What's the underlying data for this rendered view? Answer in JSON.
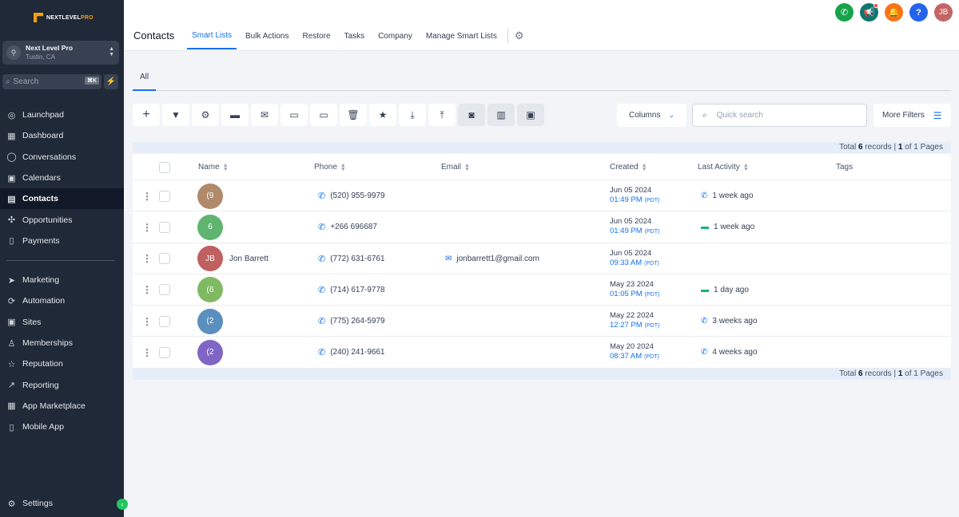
{
  "sidebar": {
    "logo_text_a": "NEXTLEVEL",
    "logo_text_b": "PRO",
    "account": {
      "name": "Next Level Pro",
      "location": "Tustin, CA"
    },
    "search": {
      "placeholder": "Search",
      "shortcut": "⌘K"
    },
    "nav_top": [
      {
        "label": "Launchpad",
        "icon": "rocket-icon",
        "glyph": "◎"
      },
      {
        "label": "Dashboard",
        "icon": "dashboard-icon",
        "glyph": "▦"
      },
      {
        "label": "Conversations",
        "icon": "chat-icon",
        "glyph": "◯"
      },
      {
        "label": "Calendars",
        "icon": "calendar-icon",
        "glyph": "▣"
      },
      {
        "label": "Contacts",
        "icon": "contacts-icon",
        "glyph": "▤",
        "active": true
      },
      {
        "label": "Opportunities",
        "icon": "opportunities-icon",
        "glyph": "✣"
      },
      {
        "label": "Payments",
        "icon": "payments-icon",
        "glyph": "▯"
      }
    ],
    "nav_bottom": [
      {
        "label": "Marketing",
        "icon": "send-icon",
        "glyph": "➤"
      },
      {
        "label": "Automation",
        "icon": "automation-icon",
        "glyph": "⟳"
      },
      {
        "label": "Sites",
        "icon": "sites-icon",
        "glyph": "▣"
      },
      {
        "label": "Memberships",
        "icon": "memberships-icon",
        "glyph": "♙"
      },
      {
        "label": "Reputation",
        "icon": "star-icon",
        "glyph": "☆"
      },
      {
        "label": "Reporting",
        "icon": "chart-icon",
        "glyph": "↗"
      },
      {
        "label": "App Marketplace",
        "icon": "apps-icon",
        "glyph": "▦"
      },
      {
        "label": "Mobile App",
        "icon": "mobile-icon",
        "glyph": "▯"
      }
    ],
    "settings_label": "Settings"
  },
  "header": {
    "title": "Contacts",
    "tabs": [
      "Smart Lists",
      "Bulk Actions",
      "Restore",
      "Tasks",
      "Company",
      "Manage Smart Lists"
    ],
    "avatar_initials": "JB"
  },
  "subtab": "All",
  "toolbar": {
    "columns_label": "Columns",
    "search_placeholder": "Quick search",
    "more_filters_label": "More Filters"
  },
  "totals": {
    "prefix": "Total ",
    "count": "6",
    "mid": " records | ",
    "page": "1",
    "suffix": " of 1 Pages"
  },
  "table": {
    "headers": {
      "name": "Name",
      "phone": "Phone",
      "email": "Email",
      "created": "Created",
      "last_activity": "Last Activity",
      "tags": "Tags"
    },
    "rows": [
      {
        "initials": "(9",
        "avatar_color": "#b08a6a",
        "name": "",
        "phone": "(520) 955-9979",
        "email": "",
        "date": "Jun 05 2024",
        "time": "01:49 PM",
        "tz": "(PDT)",
        "activity": "1 week ago",
        "activity_type": "phone"
      },
      {
        "initials": "6",
        "avatar_color": "#5fb56f",
        "name": "",
        "phone": "+266 696687",
        "email": "",
        "date": "Jun 05 2024",
        "time": "01:49 PM",
        "tz": "(PDT)",
        "activity": "1 week ago",
        "activity_type": "sms"
      },
      {
        "initials": "JB",
        "avatar_color": "#c06060",
        "name": "Jon Barrett",
        "phone": "(772) 631-6761",
        "email": "jonbarrett1@gmail.com",
        "date": "Jun 05 2024",
        "time": "09:33 AM",
        "tz": "(PDT)",
        "activity": "",
        "activity_type": ""
      },
      {
        "initials": "(6",
        "avatar_color": "#7fba62",
        "name": "",
        "phone": "(714) 617-9778",
        "email": "",
        "date": "May 23 2024",
        "time": "01:05 PM",
        "tz": "(PDT)",
        "activity": "1 day ago",
        "activity_type": "sms"
      },
      {
        "initials": "(2",
        "avatar_color": "#5b8fbe",
        "name": "",
        "phone": "(775) 264-5979",
        "email": "",
        "date": "May 22 2024",
        "time": "12:27 PM",
        "tz": "(PDT)",
        "activity": "3 weeks ago",
        "activity_type": "phone"
      },
      {
        "initials": "(2",
        "avatar_color": "#7f66c4",
        "name": "",
        "phone": "(240) 241-9661",
        "email": "",
        "date": "May 20 2024",
        "time": "08:37 AM",
        "tz": "(PDT)",
        "activity": "4 weeks ago",
        "activity_type": "phone"
      }
    ]
  },
  "colors": {
    "accent": "#1570ef",
    "sidebar_bg": "#1f2937",
    "success": "#22c55e"
  }
}
